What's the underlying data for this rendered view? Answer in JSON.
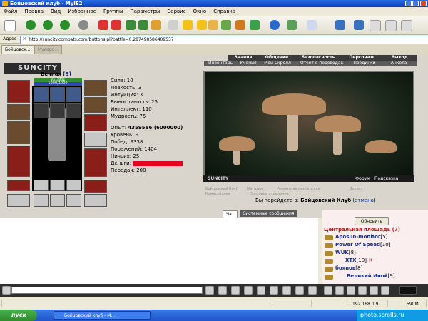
{
  "window": {
    "title": "Бойцовский клуб - MyIE2"
  },
  "menu": [
    "Файл",
    "Правка",
    "Вид",
    "Избранное",
    "Группы",
    "Параметры",
    "Сервис",
    "Окно",
    "Справка"
  ],
  "address": {
    "label": "Адрес",
    "url": "http://suncity.combats.com/buttons.pl?battle=0.287498586409537"
  },
  "tabs": [
    {
      "label": "Бойцовск..."
    },
    {
      "label": "Мусоро..."
    }
  ],
  "game": {
    "logo": "SUNCITY",
    "nav_top": [
      "Знания",
      "Общение",
      "Безопасность",
      "Персонаж",
      "Выход"
    ],
    "nav_second": [
      "Инвентарь",
      "Умения",
      "Мой Скролл",
      "Отчет о переводах",
      "Поединки",
      "Анкета"
    ],
    "character": {
      "name": "Вечная",
      "level": "[9]",
      "hp": "931/931",
      "mp": "1900/1900"
    },
    "attrs": [
      {
        "label": "Сила:",
        "value": "10"
      },
      {
        "label": "Ловкость:",
        "value": "3"
      },
      {
        "label": "Интуиция:",
        "value": "3"
      },
      {
        "label": "Выносливость:",
        "value": "25"
      },
      {
        "label": "Интеллект:",
        "value": "110"
      },
      {
        "label": "Мудрость:",
        "value": "75"
      }
    ],
    "progress": [
      {
        "label": "Опыт:",
        "value": "4359586 (6000000)"
      },
      {
        "label": "Уровень:",
        "value": "9"
      },
      {
        "label": "Побед:",
        "value": "9338"
      },
      {
        "label": "Поражений:",
        "value": "1404"
      },
      {
        "label": "Ничьих:",
        "value": "25"
      },
      {
        "label": "Деньги:",
        "value": ""
      },
      {
        "label": "Передач:",
        "value": "200"
      }
    ],
    "scene": {
      "caption": "SUNCITY",
      "forum": "Форум",
      "hint": "Подсказка"
    },
    "locations": [
      "Бойцовский Клуб",
      "Магазин",
      "Ремонтная мастерская",
      "Вокзал",
      "Комиссионка",
      "Почтовое отделение"
    ],
    "transition": {
      "prefix": "Вы перейдете в:",
      "place": "Бойцовский Клуб",
      "cancel": "отмена"
    }
  },
  "chat": {
    "tabs": [
      "Чат",
      "Системные сообщения"
    ],
    "refresh": "Обновить",
    "room": "Центральная площадь (7)",
    "users": [
      {
        "name": "Aposun-monitor",
        "level": "[5]"
      },
      {
        "name": "Power Of Speed",
        "level": "[10]"
      },
      {
        "name": "WUK",
        "level": "[8]"
      },
      {
        "name": "XTX",
        "level": "[10]"
      },
      {
        "name": "боянов",
        "level": "[8]"
      },
      {
        "name": "Великий Иной",
        "level": "[9]"
      }
    ]
  },
  "statusbar": {
    "ip": "192.168.0.9",
    "memory": "590M"
  },
  "taskbar": {
    "start": "пуск",
    "task": "Бойцовский клуб - M...",
    "watermark": "photo.scrolls.ru"
  }
}
